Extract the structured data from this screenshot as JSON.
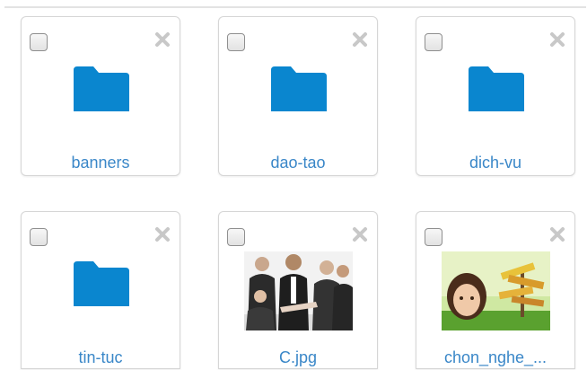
{
  "items": [
    {
      "name": "banners",
      "type": "folder"
    },
    {
      "name": "dao-tao",
      "type": "folder"
    },
    {
      "name": "dich-vu",
      "type": "folder"
    },
    {
      "name": "tin-tuc",
      "type": "folder"
    },
    {
      "name": "C.jpg",
      "type": "image"
    },
    {
      "name": "chon_nghe_...",
      "type": "image"
    }
  ],
  "colors": {
    "folder": "#0a86cf",
    "label": "#3a87c8",
    "close": "#c8c8c8",
    "tile_border": "#d6d6d6"
  },
  "icons": {
    "close": "close-icon",
    "folder": "folder-icon",
    "checkbox": "checkbox"
  }
}
